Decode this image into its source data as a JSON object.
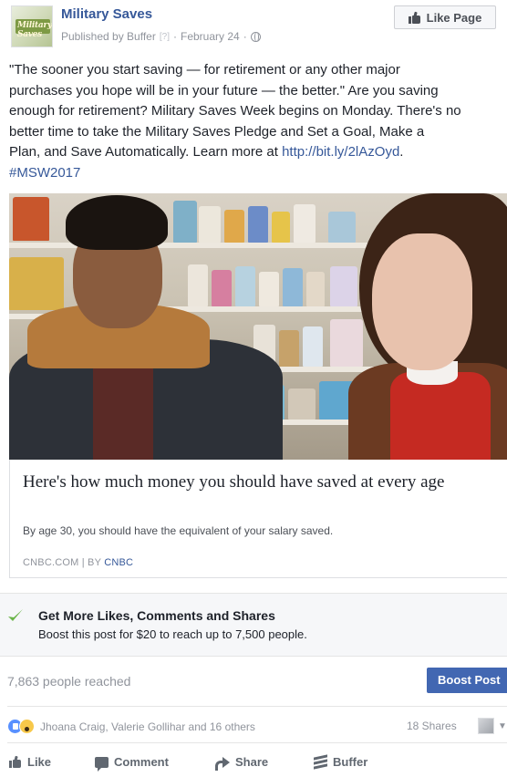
{
  "page": {
    "name": "Military Saves",
    "avatar_logo_text": "Military Saves",
    "published_by": "Published by Buffer",
    "help_mark": "[?]",
    "separator": "·",
    "date": "February 24",
    "separator2": "·",
    "audience_icon": "globe-icon",
    "like_page_label": "Like Page"
  },
  "post": {
    "lines": [
      "\"The sooner you start saving — for retirement or any other major",
      "purchases you hope will be in your future — the better.\" Are you saving",
      "enough for retirement? Military Saves Week begins on Monday. There's no",
      "better time to take the Military Saves Pledge and Set a Goal, Make a"
    ],
    "line5_text": "Plan, and Save Automatically. Learn more at ",
    "link": "http://bit.ly/2lAzOyd",
    "line5_end": ".",
    "hashtag": "#MSW2017"
  },
  "preview": {
    "headline": "Here's how much money you should have saved at every age",
    "description": "By age 30, you should have the equivalent of your salary saved.",
    "source_prefix": "CNBC.COM | BY ",
    "source_author": "CNBC"
  },
  "boost": {
    "title": "Get More Likes, Comments and Shares",
    "subtitle": "Boost this post for $20 to reach up to 7,500 people.",
    "reached": "7,863 people reached",
    "button_label": "Boost Post"
  },
  "engagement": {
    "reaction_icons": [
      "like-reaction-icon",
      "wow-reaction-icon"
    ],
    "names": "Jhoana Craig, Valerie Gollihar and 16 others",
    "shares": "18 Shares"
  },
  "actions": {
    "like": "Like",
    "comment": "Comment",
    "share": "Share",
    "buffer": "Buffer"
  },
  "colors": {
    "link_blue": "#365899",
    "button_blue": "#4267b2",
    "muted_gray": "#90949c",
    "boost_check_green": "#6bb54a"
  }
}
